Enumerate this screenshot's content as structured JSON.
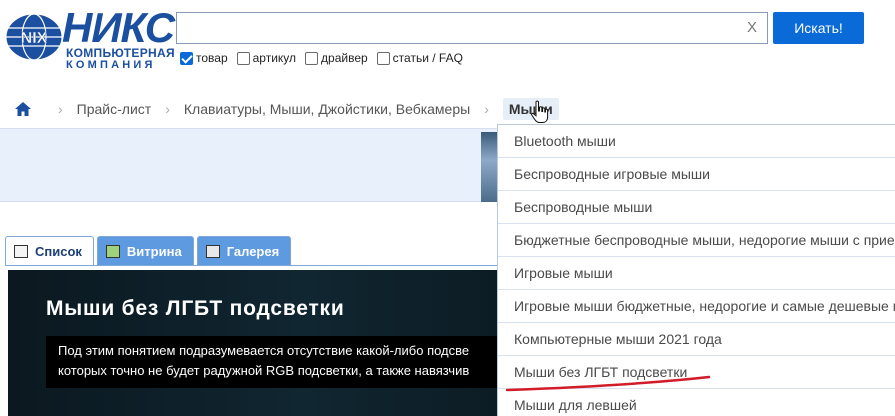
{
  "logo": {
    "name": "НИКС",
    "line1": "КОМПЬЮТЕРНАЯ",
    "line2": "КОМПАНИЯ"
  },
  "search": {
    "value": "",
    "clear_label": "X",
    "button_label": "Искать!",
    "options": [
      {
        "label": "товар",
        "checked": true
      },
      {
        "label": "артикул",
        "checked": false
      },
      {
        "label": "драйвер",
        "checked": false
      },
      {
        "label": "статьи / FAQ",
        "checked": false
      }
    ]
  },
  "breadcrumb": {
    "home_icon": "home-icon",
    "items": [
      "Прайс-лист",
      "Клавиатуры, Мыши, Джойстики, Вебкамеры",
      "Мыши"
    ]
  },
  "tabs": [
    {
      "label": "Список",
      "active": true
    },
    {
      "label": "Витрина",
      "active": false
    },
    {
      "label": "Галерея",
      "active": false
    }
  ],
  "hero": {
    "title": "Мыши без ЛГБТ подсветки",
    "desc_line1": "Под этим понятием подразумевается отсутствие какой-либо подсве",
    "desc_line2": "которых точно не будет радужной RGB подсветки, а также навязчив"
  },
  "dropdown": {
    "items": [
      "Bluetooth мыши",
      "Беспроводные игровые мыши",
      "Беспроводные мыши",
      "Бюджетные беспроводные мыши, недорогие мыши с прие",
      "Игровые мыши",
      "Игровые мыши бюджетные, недорогие и самые дешевые м",
      "Компьютерные мыши 2021 года",
      "Мыши без ЛГБТ подсветки",
      "Мыши для левшей"
    ]
  },
  "colors": {
    "brand": "#1b4fa0",
    "accent": "#0a6ad8",
    "underline": "#d21c2a"
  }
}
